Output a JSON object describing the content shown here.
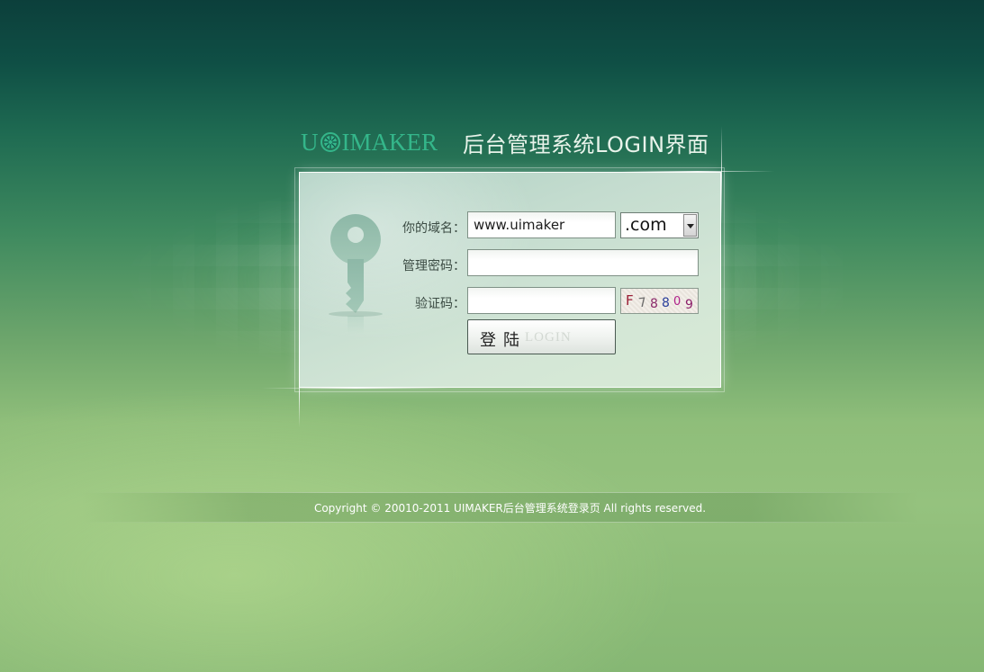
{
  "header": {
    "logo_text_pre": "U",
    "logo_text_post": "IMAKER",
    "title": "后台管理系统LOGIN界面"
  },
  "form": {
    "domain_label": "你的域名：",
    "domain_value": "www.uimaker",
    "domain_suffix": ".com",
    "password_label": "管理密码：",
    "password_value": "",
    "captcha_label": "验证码：",
    "captcha_value": "",
    "captcha_chars": [
      "F",
      "7",
      "8",
      "8",
      "0",
      "9"
    ],
    "login_cn": "登陆",
    "login_en": "LOGIN"
  },
  "footer": {
    "copyright": "Copyright © 20010-2011 UIMAKER后台管理系统登录页 All rights reserved."
  },
  "colors": {
    "logo": "#34b68a",
    "background_top": "#0c3f3b",
    "background_bottom": "#86b774"
  },
  "icons": [
    "wheel-logo-icon",
    "key-icon",
    "chevron-down-icon"
  ]
}
